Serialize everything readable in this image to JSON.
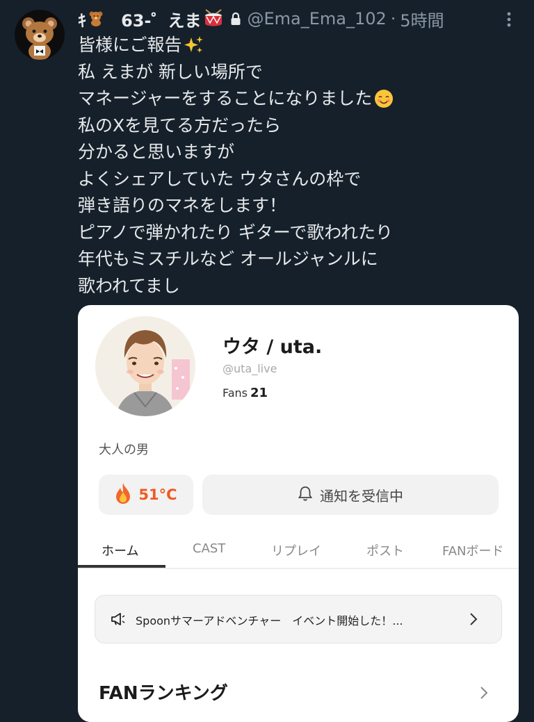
{
  "header": {
    "display_name_pre": "ｷ",
    "display_name_mid": "ㅤ63-゜えま",
    "handle": "@Ema_Ema_102",
    "separator": "·",
    "time": "5時間"
  },
  "tweet": {
    "lines": [
      "皆様にご報告",
      "私 えまが 新しい場所で",
      "マネージャーをすることになりました",
      "私のXを見てる方だったら",
      "分かると思いますが",
      "よくシェアしていた ウタさんの枠で",
      "弾き語りのマネをします！",
      "ピアノで弾かれたり ギターで歌われたり",
      "年代もミスチルなど オールジャンルに",
      "歌われてまし"
    ]
  },
  "card": {
    "profile_name": "ウタ / uta.",
    "profile_handle": "@uta_live",
    "fans_label": "Fans",
    "fans_count": "21",
    "bio": "大人の男",
    "temperature": "51°C",
    "notify_label": "通知を受信中",
    "tabs": [
      "ホーム",
      "CAST",
      "リプレイ",
      "ポスト",
      "FANボード"
    ],
    "active_tab": "ホーム",
    "banner_text": "Spoonサマーアドベンチャー　イベント開始した！...",
    "ranking_title": "FANランキング"
  },
  "colors": {
    "background": "#15202b",
    "temperature": "#f05a24",
    "secondary_text": "#8b98a5"
  }
}
